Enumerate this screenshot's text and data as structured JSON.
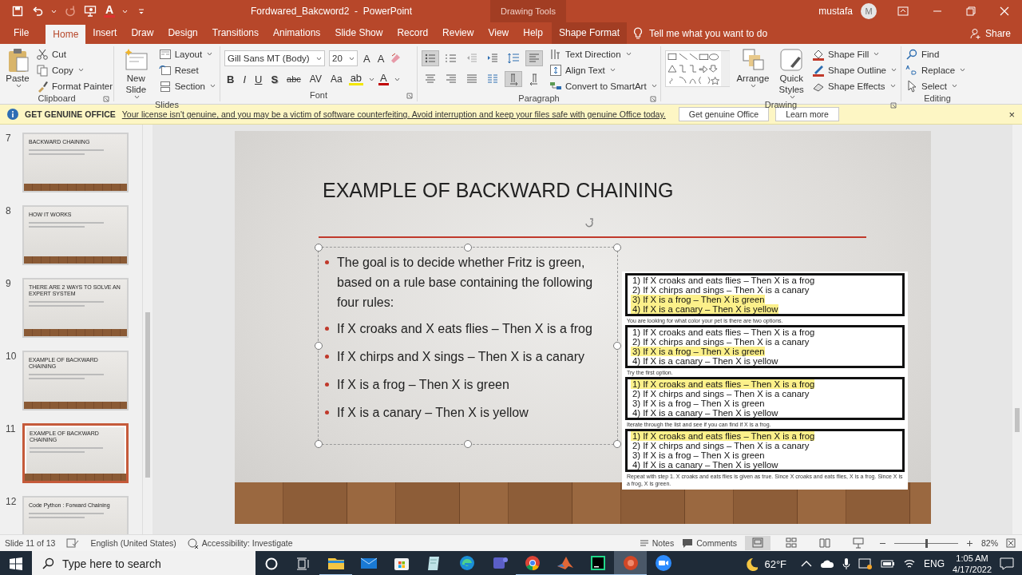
{
  "title_bar": {
    "quick_access": [
      {
        "kind": "save",
        "disabled": false
      },
      {
        "kind": "undo",
        "disabled": false
      },
      {
        "kind": "redo",
        "disabled": true
      },
      {
        "kind": "present",
        "disabled": false
      },
      {
        "kind": "font-color",
        "label": "A",
        "disabled": false
      },
      {
        "kind": "customize",
        "disabled": false
      }
    ],
    "document_title": "Fordwared_Bakcword2  -  PowerPoint",
    "context_label": "Drawing Tools",
    "user_name": "mustafa",
    "avatar_initial": "M"
  },
  "ribbon_tabs": [
    {
      "label": "File",
      "selected": false,
      "kind": "normal"
    },
    {
      "label": "Home",
      "selected": true,
      "kind": "normal"
    },
    {
      "label": "Insert",
      "selected": false,
      "kind": "normal"
    },
    {
      "label": "Draw",
      "selected": false,
      "kind": "normal"
    },
    {
      "label": "Design",
      "selected": false,
      "kind": "normal"
    },
    {
      "label": "Transitions",
      "selected": false,
      "kind": "normal"
    },
    {
      "label": "Animations",
      "selected": false,
      "kind": "normal"
    },
    {
      "label": "Slide Show",
      "selected": false,
      "kind": "normal"
    },
    {
      "label": "Record",
      "selected": false,
      "kind": "normal"
    },
    {
      "label": "Review",
      "selected": false,
      "kind": "normal"
    },
    {
      "label": "View",
      "selected": false,
      "kind": "normal"
    },
    {
      "label": "Help",
      "selected": false,
      "kind": "normal"
    },
    {
      "label": "Shape Format",
      "selected": false,
      "kind": "contextual"
    }
  ],
  "tell_me": {
    "placeholder": "Tell me what you want to do"
  },
  "share": "Share",
  "ribbon": {
    "groups": [
      {
        "kind": "clipboard",
        "label": "Clipboard",
        "launcher": true,
        "large": [
          "Paste"
        ],
        "small": [
          {
            "label": "Cut",
            "dropdown": false
          },
          {
            "label": "Copy",
            "dropdown": true
          },
          {
            "label": "Format Painter",
            "dropdown": false
          }
        ]
      },
      {
        "kind": "slides",
        "label": "Slides",
        "launcher": false,
        "large": [
          "New Slide"
        ],
        "small": [
          {
            "label": "Layout",
            "dropdown": true
          },
          {
            "label": "Reset",
            "dropdown": false
          },
          {
            "label": "Section",
            "dropdown": true
          }
        ]
      },
      {
        "kind": "font",
        "label": "Font",
        "launcher": true,
        "font_name": "Gill Sans MT (Body)",
        "font_size": "20",
        "size_buttons": [
          "A",
          "A"
        ],
        "format_buttons": [
          "B",
          "I",
          "U",
          "S",
          "abc",
          "AV",
          "Aa"
        ],
        "color_buttons": [
          {
            "label": "ab",
            "color": "#f2e600"
          },
          {
            "label": "A",
            "color": "#c00000"
          }
        ]
      },
      {
        "kind": "paragraph",
        "label": "Paragraph",
        "launcher": true,
        "icon_buttons": [
          {
            "kind": "bullets",
            "selected": true
          },
          {
            "kind": "numbering",
            "selected": false
          },
          {
            "kind": "decrease-indent",
            "selected": false
          },
          {
            "kind": "increase-indent",
            "selected": false
          },
          {
            "kind": "line-spacing",
            "selected": false
          },
          {
            "kind": "align-left",
            "selected": true
          },
          {
            "kind": "center",
            "selected": false
          },
          {
            "kind": "align-right",
            "selected": false
          },
          {
            "kind": "justify",
            "selected": false
          },
          {
            "kind": "columns",
            "selected": false
          },
          {
            "kind": "ltr",
            "selected": true
          },
          {
            "kind": "rtl",
            "selected": false
          }
        ],
        "small": [
          {
            "label": "Text Direction",
            "dropdown": true
          },
          {
            "label": "Align Text",
            "dropdown": true
          },
          {
            "label": "Convert to SmartArt",
            "dropdown": true
          }
        ]
      },
      {
        "kind": "drawing",
        "label": "Drawing",
        "launcher": true,
        "large": [
          "Arrange",
          "Quick Styles"
        ],
        "small": [
          {
            "label": "Shape Fill",
            "dropdown": true
          },
          {
            "label": "Shape Outline",
            "dropdown": true
          },
          {
            "label": "Shape Effects",
            "dropdown": true
          }
        ]
      },
      {
        "kind": "editing",
        "label": "Editing",
        "launcher": false,
        "small": [
          {
            "label": "Find",
            "dropdown": false
          },
          {
            "label": "Replace",
            "dropdown": true
          },
          {
            "label": "Select",
            "dropdown": true
          }
        ]
      }
    ]
  },
  "banner": {
    "title": "GET GENUINE OFFICE",
    "message": "Your license isn't genuine, and you may be a victim of software counterfeiting. Avoid interruption and keep your files safe with genuine Office today.",
    "buttons": [
      "Get genuine Office",
      "Learn more"
    ],
    "close": "×"
  },
  "thumbnails": [
    {
      "number": "7",
      "title": "BACKWARD CHAINING",
      "selected": false
    },
    {
      "number": "8",
      "title": "HOW IT WORKS",
      "selected": false
    },
    {
      "number": "9",
      "title": "THERE ARE 2 WAYS TO SOLVE AN EXPERT SYSTEM",
      "selected": false
    },
    {
      "number": "10",
      "title": "EXAMPLE OF BACKWARD CHAINING",
      "selected": false
    },
    {
      "number": "11",
      "title": "EXAMPLE OF BACKWARD CHAINING",
      "selected": true
    },
    {
      "number": "12",
      "title": "Code Python : Forward Chaining",
      "selected": false
    }
  ],
  "slide": {
    "title": "EXAMPLE OF BACKWARD CHAINING",
    "bullets": [
      "The goal is to decide whether Fritz is green, based on a rule base containing the following four rules:",
      "If X croaks and X eats flies – Then X is a frog",
      "If X chirps and X sings – Then X is a canary",
      "If X is a frog – Then X is green",
      "If X is a canary – Then X is yellow"
    ],
    "picture": [
      {
        "rules": [
          {
            "text": "1) If X croaks and eats flies – Then X is a frog",
            "highlighted": false
          },
          {
            "text": "2) If X chirps and sings – Then X is a canary",
            "highlighted": false
          },
          {
            "text": "3) If X is a frog – Then X is green",
            "highlighted": true
          },
          {
            "text": "4) If X is a canary – Then X is yellow",
            "highlighted": true
          }
        ],
        "caption": "You are looking for what color your pet is there are two options."
      },
      {
        "rules": [
          {
            "text": "1) If X croaks and eats flies – Then X is a frog",
            "highlighted": false
          },
          {
            "text": "2) If X chirps and sings – Then X is a canary",
            "highlighted": false
          },
          {
            "text": "3) If X is a frog – Then X is green",
            "highlighted": true
          },
          {
            "text": "4) If X is a canary – Then X is yellow",
            "highlighted": false
          }
        ],
        "caption": "Try the first option."
      },
      {
        "rules": [
          {
            "text": "1) If X croaks and eats flies – Then X is a frog",
            "highlighted": true
          },
          {
            "text": "2) If X chirps and sings – Then X is a canary",
            "highlighted": false
          },
          {
            "text": "3) If X is a frog – Then X is green",
            "highlighted": false
          },
          {
            "text": "4) If X is a canary – Then X is yellow",
            "highlighted": false
          }
        ],
        "caption": "Iterate through the list and see if you can find if X is a frog."
      },
      {
        "rules": [
          {
            "text": "1) If X croaks and eats flies – Then X is a frog",
            "highlighted": true
          },
          {
            "text": "2) If X chirps and sings – Then X is a canary",
            "highlighted": false
          },
          {
            "text": "3) If X is a frog – Then X is green",
            "highlighted": false
          },
          {
            "text": "4) If X is a canary – Then X is yellow",
            "highlighted": false
          }
        ],
        "caption": "Repeat with step 1. X croaks and eats flies is given as true. Since X croaks and eats flies, X is a frog. Since X is a frog, X is green."
      }
    ]
  },
  "status_bar": {
    "slide_info": "Slide 11 of 13",
    "language": "English (United States)",
    "accessibility": "Accessibility: Investigate",
    "notes": "Notes",
    "comments": "Comments",
    "views": [
      {
        "kind": "normal",
        "selected": true
      },
      {
        "kind": "sorter",
        "selected": false
      },
      {
        "kind": "reading",
        "selected": false
      },
      {
        "kind": "slideshow",
        "selected": false
      }
    ],
    "zoom": {
      "level": 0.5,
      "reading": "82%"
    }
  },
  "taskbar": {
    "search": {
      "placeholder": "Type here to search"
    },
    "apps": [
      {
        "kind": "explorer",
        "running": true,
        "selected": false
      },
      {
        "kind": "mail",
        "running": false,
        "selected": false
      },
      {
        "kind": "store",
        "running": false,
        "selected": false
      },
      {
        "kind": "notepad",
        "running": false,
        "selected": false
      },
      {
        "kind": "edge",
        "running": false,
        "selected": false
      },
      {
        "kind": "teams",
        "running": false,
        "selected": false
      },
      {
        "kind": "chrome",
        "running": true,
        "selected": false
      },
      {
        "kind": "matlab",
        "running": true,
        "selected": false
      },
      {
        "kind": "pycharm",
        "running": true,
        "selected": false
      },
      {
        "kind": "powerpoint",
        "running": true,
        "selected": true
      },
      {
        "kind": "zoom",
        "running": false,
        "selected": false
      }
    ],
    "weather": "62°F",
    "language": "ENG",
    "time": "1:05 AM",
    "date": "4/17/2022"
  }
}
